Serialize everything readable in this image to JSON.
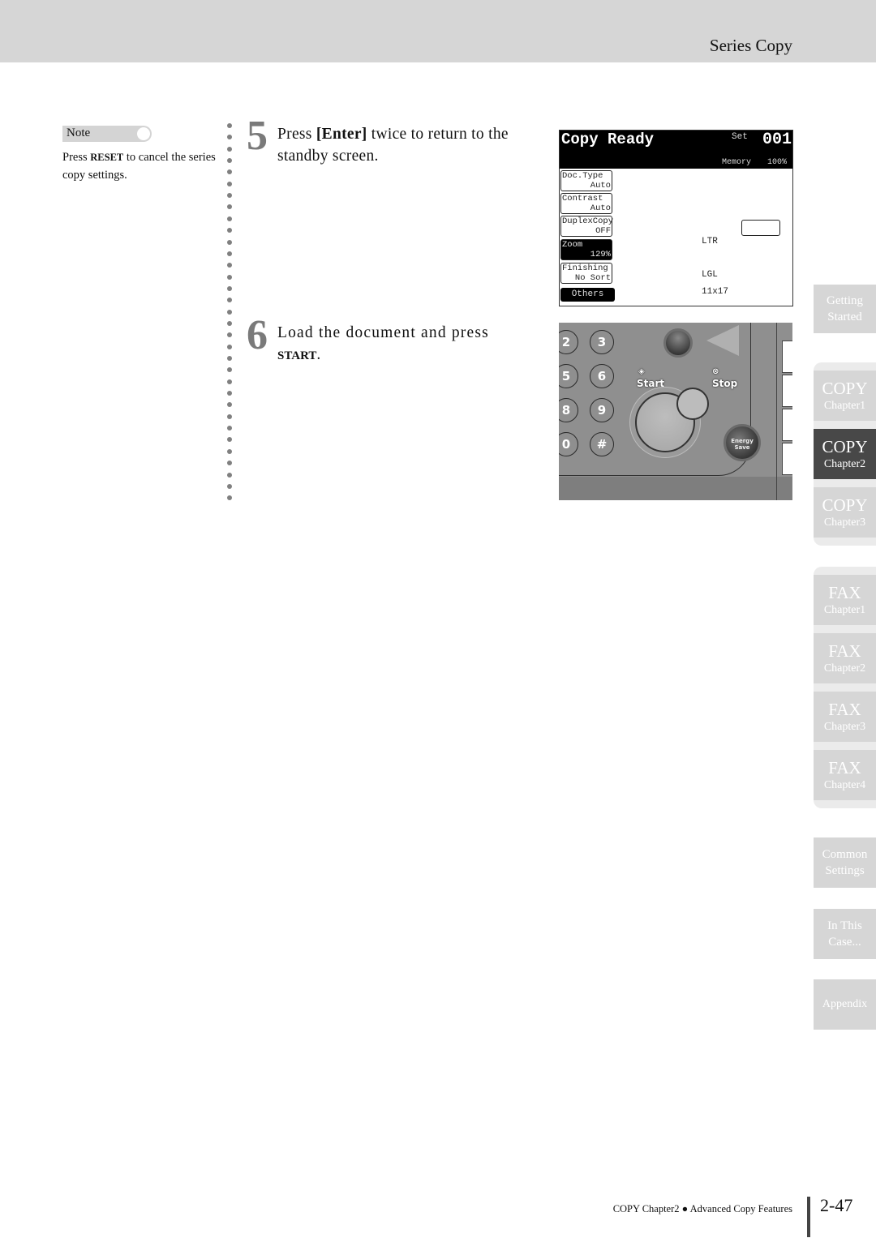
{
  "header": {
    "title": "Series Copy"
  },
  "note": {
    "label": "Note",
    "text_before": "Press ",
    "text_bold": "RESET",
    "text_after": " to cancel the series copy settings."
  },
  "steps": [
    {
      "number": "5",
      "text_before": "Press ",
      "text_bold": "[Enter]",
      "text_after": " twice to return to the standby screen."
    },
    {
      "number": "6",
      "text_before": "Load the document and press ",
      "text_bold": "START",
      "text_after": "."
    }
  ],
  "lcd": {
    "title": "Copy Ready",
    "set_label": "Set",
    "set_count": "001",
    "memory_label": "Memory",
    "memory_value": "100%",
    "buttons": [
      {
        "label": "Doc.Type",
        "value": "Auto",
        "active": false
      },
      {
        "label": "Contrast",
        "value": "Auto",
        "active": false
      },
      {
        "label": "DuplexCopy",
        "value": "OFF",
        "active": false
      },
      {
        "label": "Zoom",
        "value": "129%",
        "active": true
      },
      {
        "label": "Finishing",
        "value": "No Sort",
        "active": false
      }
    ],
    "others_label": "Others",
    "paper_sizes": [
      "LTR",
      "LGL",
      "11x17"
    ]
  },
  "control_panel": {
    "keys": [
      "2",
      "3",
      "5",
      "6",
      "8",
      "9",
      "0",
      "#"
    ],
    "start_label": "Start",
    "stop_label": "Stop",
    "energy_save_label_1": "Energy",
    "energy_save_label_2": "Save"
  },
  "tabs": [
    {
      "line1": "Getting",
      "line2": "Started",
      "active": false
    },
    {
      "line1": "COPY",
      "line2": "Chapter1",
      "active": false
    },
    {
      "line1": "COPY",
      "line2": "Chapter2",
      "active": true
    },
    {
      "line1": "COPY",
      "line2": "Chapter3",
      "active": false
    },
    {
      "line1": "FAX",
      "line2": "Chapter1",
      "active": false
    },
    {
      "line1": "FAX",
      "line2": "Chapter2",
      "active": false
    },
    {
      "line1": "FAX",
      "line2": "Chapter3",
      "active": false
    },
    {
      "line1": "FAX",
      "line2": "Chapter4",
      "active": false
    },
    {
      "line1": "Common",
      "line2": "Settings",
      "active": false
    },
    {
      "line1": "In This",
      "line2": "Case...",
      "active": false
    },
    {
      "line1": "Appendix",
      "line2": "",
      "active": false
    }
  ],
  "footer": {
    "chapter": "COPY Chapter2",
    "bullet": "●",
    "section": "Advanced Copy Features",
    "page_number": "2-47"
  }
}
